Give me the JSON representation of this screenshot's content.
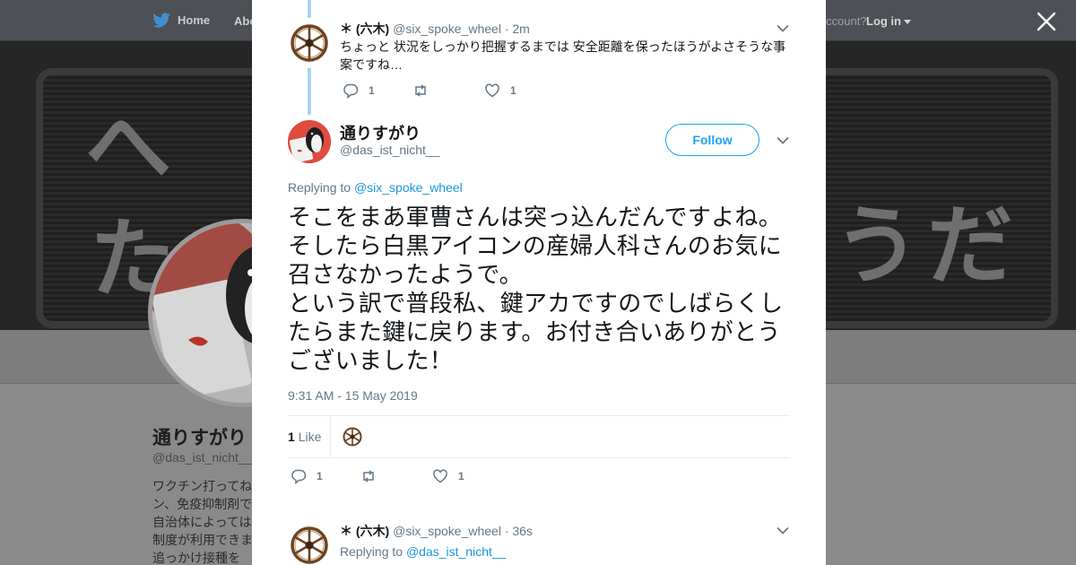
{
  "topnav": {
    "home_label": "Home",
    "about_label": "Abo",
    "account_prompt": "ccount?",
    "login_label": "Log in"
  },
  "profile": {
    "name": "通りすがり",
    "handle": "@das_ist_nicht__",
    "bio_lines": [
      "ワクチン打ってね",
      "ン、免疫抑制剤で",
      "自治体によっては",
      "制度が利用できま",
      "追っかけ接種を"
    ]
  },
  "thread": {
    "parent": {
      "name": "＊ (六木)",
      "handle": "@six_spoke_wheel",
      "time": "· 2m",
      "text": "ちょっと 状況をしっかり把握するまでは 安全距離を保ったほうがよさそうな事案ですね…",
      "replies": "1",
      "retweets": "",
      "likes": "1"
    },
    "main": {
      "name": "通りすがり",
      "handle": "@das_ist_nicht__",
      "follow_label": "Follow",
      "replying_prefix": "Replying to",
      "replying_to": "@six_spoke_wheel",
      "text": "そこをまあ軍曹さんは突っ込んだんですよね。そしたら白黒アイコンの産婦人科さんのお気に召さなかったようで。\nという訳で普段私、鍵アカですのでしばらくしたらまた鍵に戻ります。お付き合いありがとうございました！",
      "timestamp": "9:31 AM - 15 May 2019",
      "like_count": "1",
      "like_label": "Like",
      "replies": "1",
      "retweets": "",
      "likes": "1"
    },
    "reply": {
      "name": "＊ (六木)",
      "handle": "@six_spoke_wheel",
      "time": "· 36s",
      "replying_prefix": "Replying to",
      "replying_to": "@das_ist_nicht__"
    }
  },
  "colors": {
    "accent": "#1da1f2",
    "link": "#1b95e0",
    "muted": "#657786",
    "thread_line": "#a6d5f5"
  }
}
